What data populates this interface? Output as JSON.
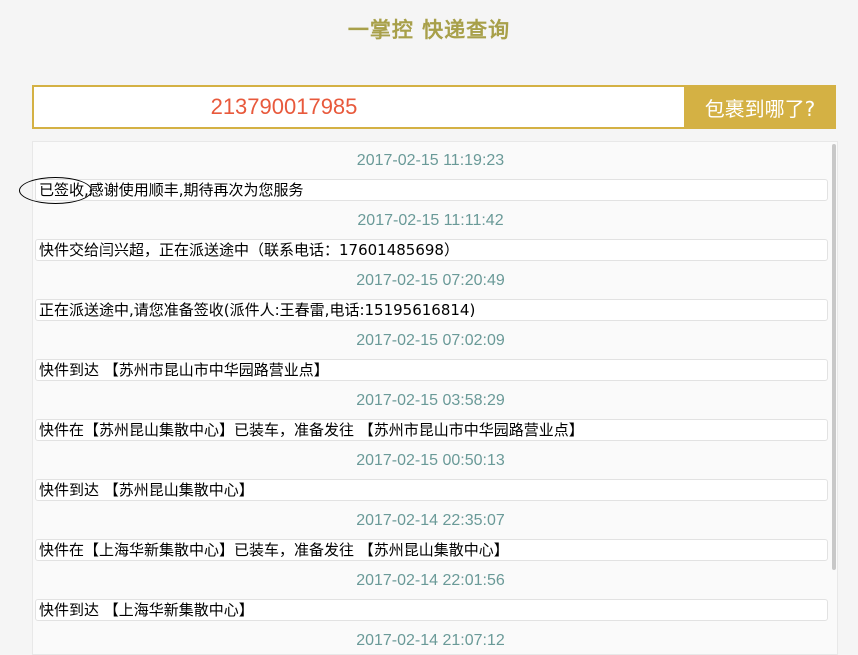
{
  "header": {
    "title": "一掌控 快递查询"
  },
  "search": {
    "tracking_number": "213790017985",
    "button_label": "包裹到哪了?"
  },
  "entries": [
    {
      "time": "2017-02-15 11:19:23",
      "status": "已签收,感谢使用顺丰,期待再次为您服务"
    },
    {
      "time": "2017-02-15 11:11:42",
      "status": "快件交给闫兴超，正在派送途中（联系电话：17601485698）"
    },
    {
      "time": "2017-02-15 07:20:49",
      "status": "正在派送途中,请您准备签收(派件人:王春雷,电话:15195616814)"
    },
    {
      "time": "2017-02-15 07:02:09",
      "status": "快件到达 【苏州市昆山市中华园路营业点】"
    },
    {
      "time": "2017-02-15 03:58:29",
      "status": "快件在【苏州昆山集散中心】已装车，准备发往 【苏州市昆山市中华园路营业点】"
    },
    {
      "time": "2017-02-15 00:50:13",
      "status": "快件到达 【苏州昆山集散中心】"
    },
    {
      "time": "2017-02-14 22:35:07",
      "status": "快件在【上海华新集散中心】已装车，准备发往 【苏州昆山集散中心】"
    },
    {
      "time": "2017-02-14 22:01:56",
      "status": "快件到达 【上海华新集散中心】"
    },
    {
      "time": "2017-02-14 21:07:12",
      "status": ""
    }
  ],
  "colors": {
    "accent": "#d4b144",
    "title": "#a8a04a",
    "tracking_number": "#e8593c",
    "timestamp": "#6a9a98"
  }
}
